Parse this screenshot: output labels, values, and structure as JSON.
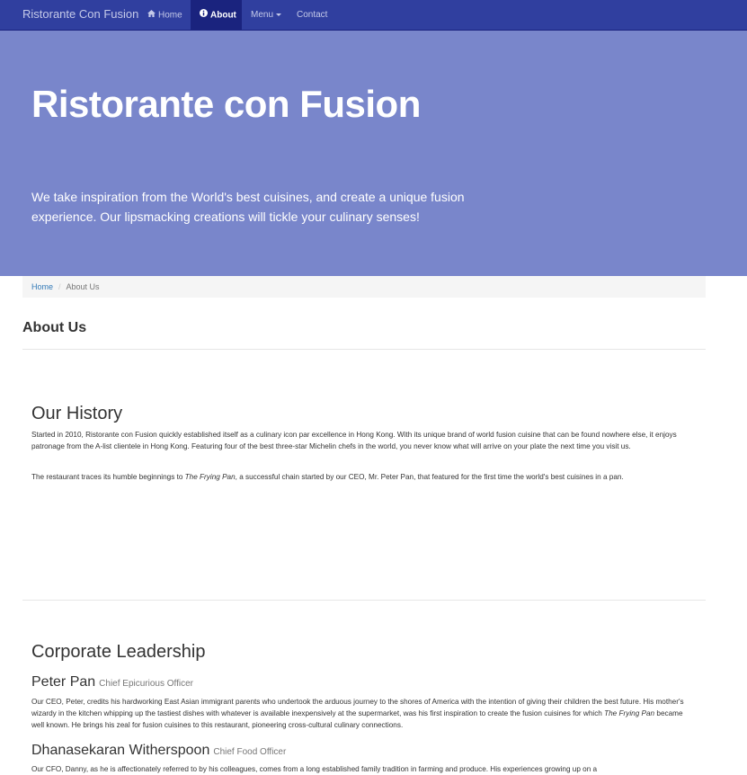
{
  "navbar": {
    "brand": "Ristorante Con Fusion",
    "items": [
      {
        "label": "Home",
        "icon": "home-icon",
        "active": false
      },
      {
        "label": "About",
        "icon": "info-circle-icon",
        "active": true
      },
      {
        "label": "Menu",
        "icon": "chevron-down-icon",
        "active": false
      },
      {
        "label": "Contact",
        "active": false
      }
    ]
  },
  "jumbotron": {
    "title": "Ristorante con Fusion",
    "text": "We take inspiration from the World's best cuisines, and create a unique fusion experience. Our lipsmacking creations will tickle your culinary senses!"
  },
  "breadcrumb": {
    "home": "Home",
    "separator": "/",
    "current": "About Us"
  },
  "page": {
    "title": "About Us"
  },
  "history": {
    "title": "Our History",
    "p1": "Started in 2010, Ristorante con Fusion quickly established itself as a culinary icon par excellence in Hong Kong. With its unique brand of world fusion cuisine that can be found nowhere else, it enjoys patronage from the A-list clientele in Hong Kong. Featuring four of the best three-star Michelin chefs in the world, you never know what will arrive on your plate the next time you visit us.",
    "p2_before": "The restaurant traces its humble beginnings to ",
    "p2_em": "The Frying Pan",
    "p2_after": ", a successful chain started by our CEO, Mr. Peter Pan, that featured for the first time the world's best cuisines in a pan."
  },
  "leadership": {
    "title": "Corporate Leadership",
    "leaders": [
      {
        "name": "Peter Pan",
        "role": "Chief Epicurious Officer",
        "bio_before": "Our CEO, Peter, credits his hardworking East Asian immigrant parents who undertook the arduous journey to the shores of America with the intention of giving their children the best future. His mother's wizardy in the kitchen whipping up the tastiest dishes with whatever is available inexpensively at the supermarket, was his first inspiration to create the fusion cuisines for which ",
        "bio_em": "The Frying Pan",
        "bio_after": " became well known. He brings his zeal for fusion cuisines to this restaurant, pioneering cross-cultural culinary connections."
      },
      {
        "name": "Dhanasekaran Witherspoon",
        "role": "Chief Food Officer",
        "bio": "Our CFO, Danny, as he is affectionately referred to by his colleagues, comes from a long established family tradition in farming and produce. His experiences growing up on a"
      }
    ]
  },
  "colors": {
    "navbar": "#303f9f",
    "navbar_active": "#1a237e",
    "jumbotron": "#7986cb",
    "link": "#337ab7"
  }
}
